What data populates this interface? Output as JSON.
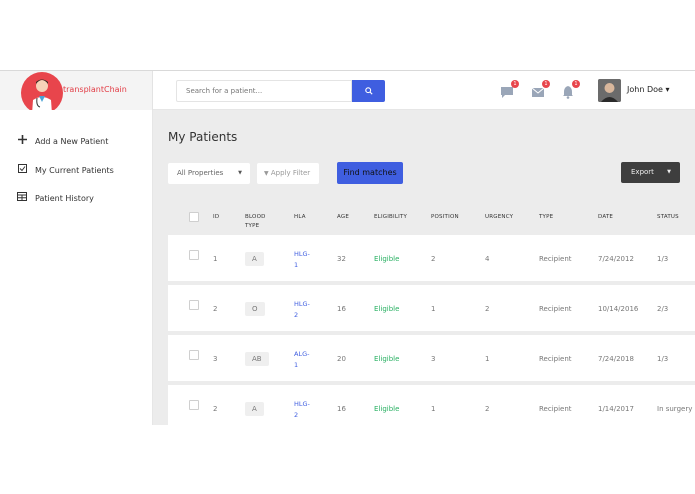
{
  "app": {
    "brand": "transplantChain"
  },
  "header": {
    "search_placeholder": "Search for a patient...",
    "messages_count": "1",
    "mail_count": "1",
    "notifications_count": "1",
    "user_name": "John Doe ▾"
  },
  "sidebar": {
    "items": [
      {
        "icon": "plus-icon",
        "label": "Add a New Patient"
      },
      {
        "icon": "checkbox-icon",
        "label": "My Current Patients"
      },
      {
        "icon": "table-icon",
        "label": "Patient History"
      }
    ]
  },
  "main": {
    "title": "My Patients",
    "filter_select": "All Properties",
    "apply_filter": "Apply Filter",
    "find_matches": "Find matches",
    "export": "Export"
  },
  "table": {
    "headers": {
      "id": "ID",
      "blood_line1": "BLOOD",
      "blood_line2": "TYPE",
      "hla": "HLA",
      "age": "AGE",
      "eligibility": "ELIGIBILITY",
      "position": "POSITION",
      "urgency": "URGENCY",
      "type": "TYPE",
      "date": "DATE",
      "status": "STATUS"
    },
    "rows": [
      {
        "id": "1",
        "blood": "A",
        "hla1": "HLG-",
        "hla2": "1",
        "age": "32",
        "eligibility": "Eligible",
        "position": "2",
        "urgency": "4",
        "type": "Recipient",
        "date": "7/24/2012",
        "status": "1/3"
      },
      {
        "id": "2",
        "blood": "O",
        "hla1": "HLG-",
        "hla2": "2",
        "age": "16",
        "eligibility": "Eligible",
        "position": "1",
        "urgency": "2",
        "type": "Recipient",
        "date": "10/14/2016",
        "status": "2/3"
      },
      {
        "id": "3",
        "blood": "AB",
        "hla1": "ALG-",
        "hla2": "1",
        "age": "20",
        "eligibility": "Eligible",
        "position": "3",
        "urgency": "1",
        "type": "Recipient",
        "date": "7/24/2018",
        "status": "1/3"
      },
      {
        "id": "2",
        "blood": "A",
        "hla1": "HLG-",
        "hla2": "2",
        "age": "16",
        "eligibility": "Eligible",
        "position": "1",
        "urgency": "2",
        "type": "Recipient",
        "date": "1/14/2017",
        "status": "In surgery"
      }
    ]
  },
  "colors": {
    "accent": "#3f5ee0",
    "brand": "#e8454c",
    "eligible": "#27b062"
  }
}
